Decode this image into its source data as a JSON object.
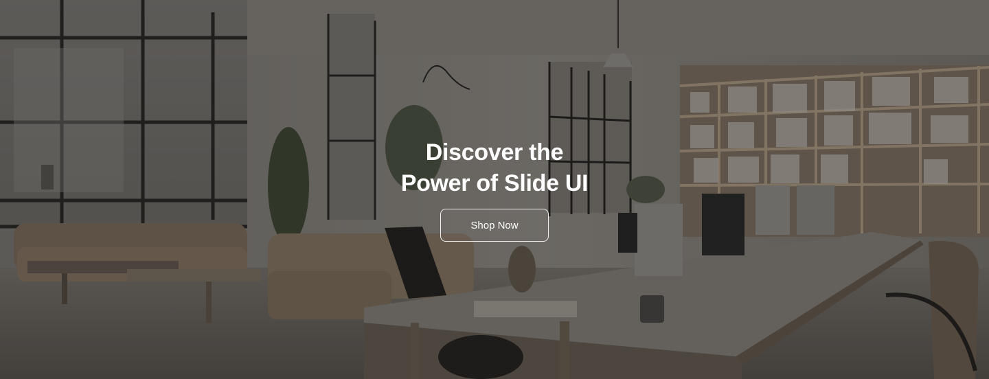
{
  "hero": {
    "headline_line1": "Discover the",
    "headline_line2": "Power of Slide UI",
    "button_label": "Shop Now"
  },
  "colors": {
    "text": "#ffffff",
    "overlay": "rgba(28,26,24,0.42)",
    "button_border": "#ffffff"
  }
}
